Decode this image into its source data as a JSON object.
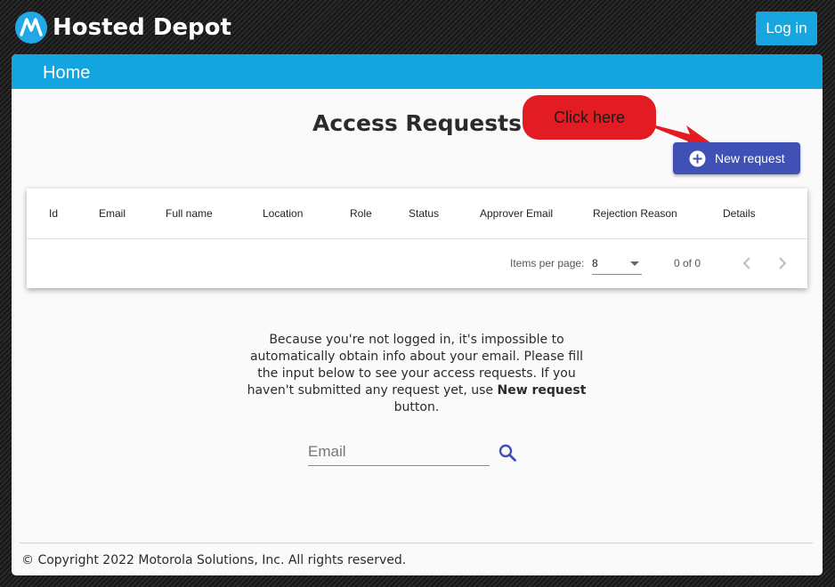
{
  "header": {
    "brand": "Hosted Depot",
    "login_label": "Log in",
    "logo_icon": "motorola-logo-icon"
  },
  "nav": {
    "home_label": "Home"
  },
  "main": {
    "title": "Access Requests",
    "callout": "Click here",
    "new_request_label": "New request",
    "table": {
      "columns": [
        "Id",
        "Email",
        "Full name",
        "Location",
        "Role",
        "Status",
        "Approver Email",
        "Rejection Reason",
        "Details"
      ]
    },
    "paginator": {
      "items_per_page_label": "Items per page:",
      "items_per_page_value": "8",
      "range_label": "0 of 0"
    },
    "info": {
      "text_before": "Because you're not logged in, it's impossible to automatically obtain info about your email. Please fill the input below to see your access requests. If you haven't submitted any request yet, use ",
      "bold": "New request",
      "text_after": " button."
    },
    "email_placeholder": "Email"
  },
  "footer": {
    "copyright": "© Copyright 2022 Motorola Solutions, Inc. All rights reserved."
  },
  "colors": {
    "brand_blue": "#14a5e0",
    "indigo": "#3f51b5",
    "callout_red": "#e31b23"
  }
}
